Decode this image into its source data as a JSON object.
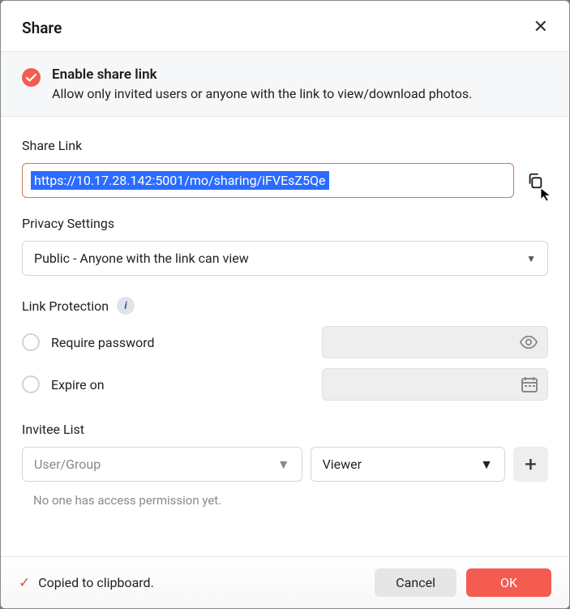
{
  "dialog": {
    "title": "Share",
    "enable": {
      "title": "Enable share link",
      "description": "Allow only invited users or anyone with the link to view/download photos."
    },
    "shareLink": {
      "label": "Share Link",
      "url": "https://10.17.28.142:5001/mo/sharing/iFVEsZ5Qe"
    },
    "privacy": {
      "label": "Privacy Settings",
      "selected": "Public - Anyone with the link can view"
    },
    "protection": {
      "label": "Link Protection",
      "password_label": "Require password",
      "expire_label": "Expire on"
    },
    "invitee": {
      "label": "Invitee List",
      "user_placeholder": "User/Group",
      "role_selected": "Viewer",
      "empty_message": "No one has access permission yet."
    },
    "toast": "Copied to clipboard.",
    "buttons": {
      "cancel": "Cancel",
      "ok": "OK"
    }
  }
}
